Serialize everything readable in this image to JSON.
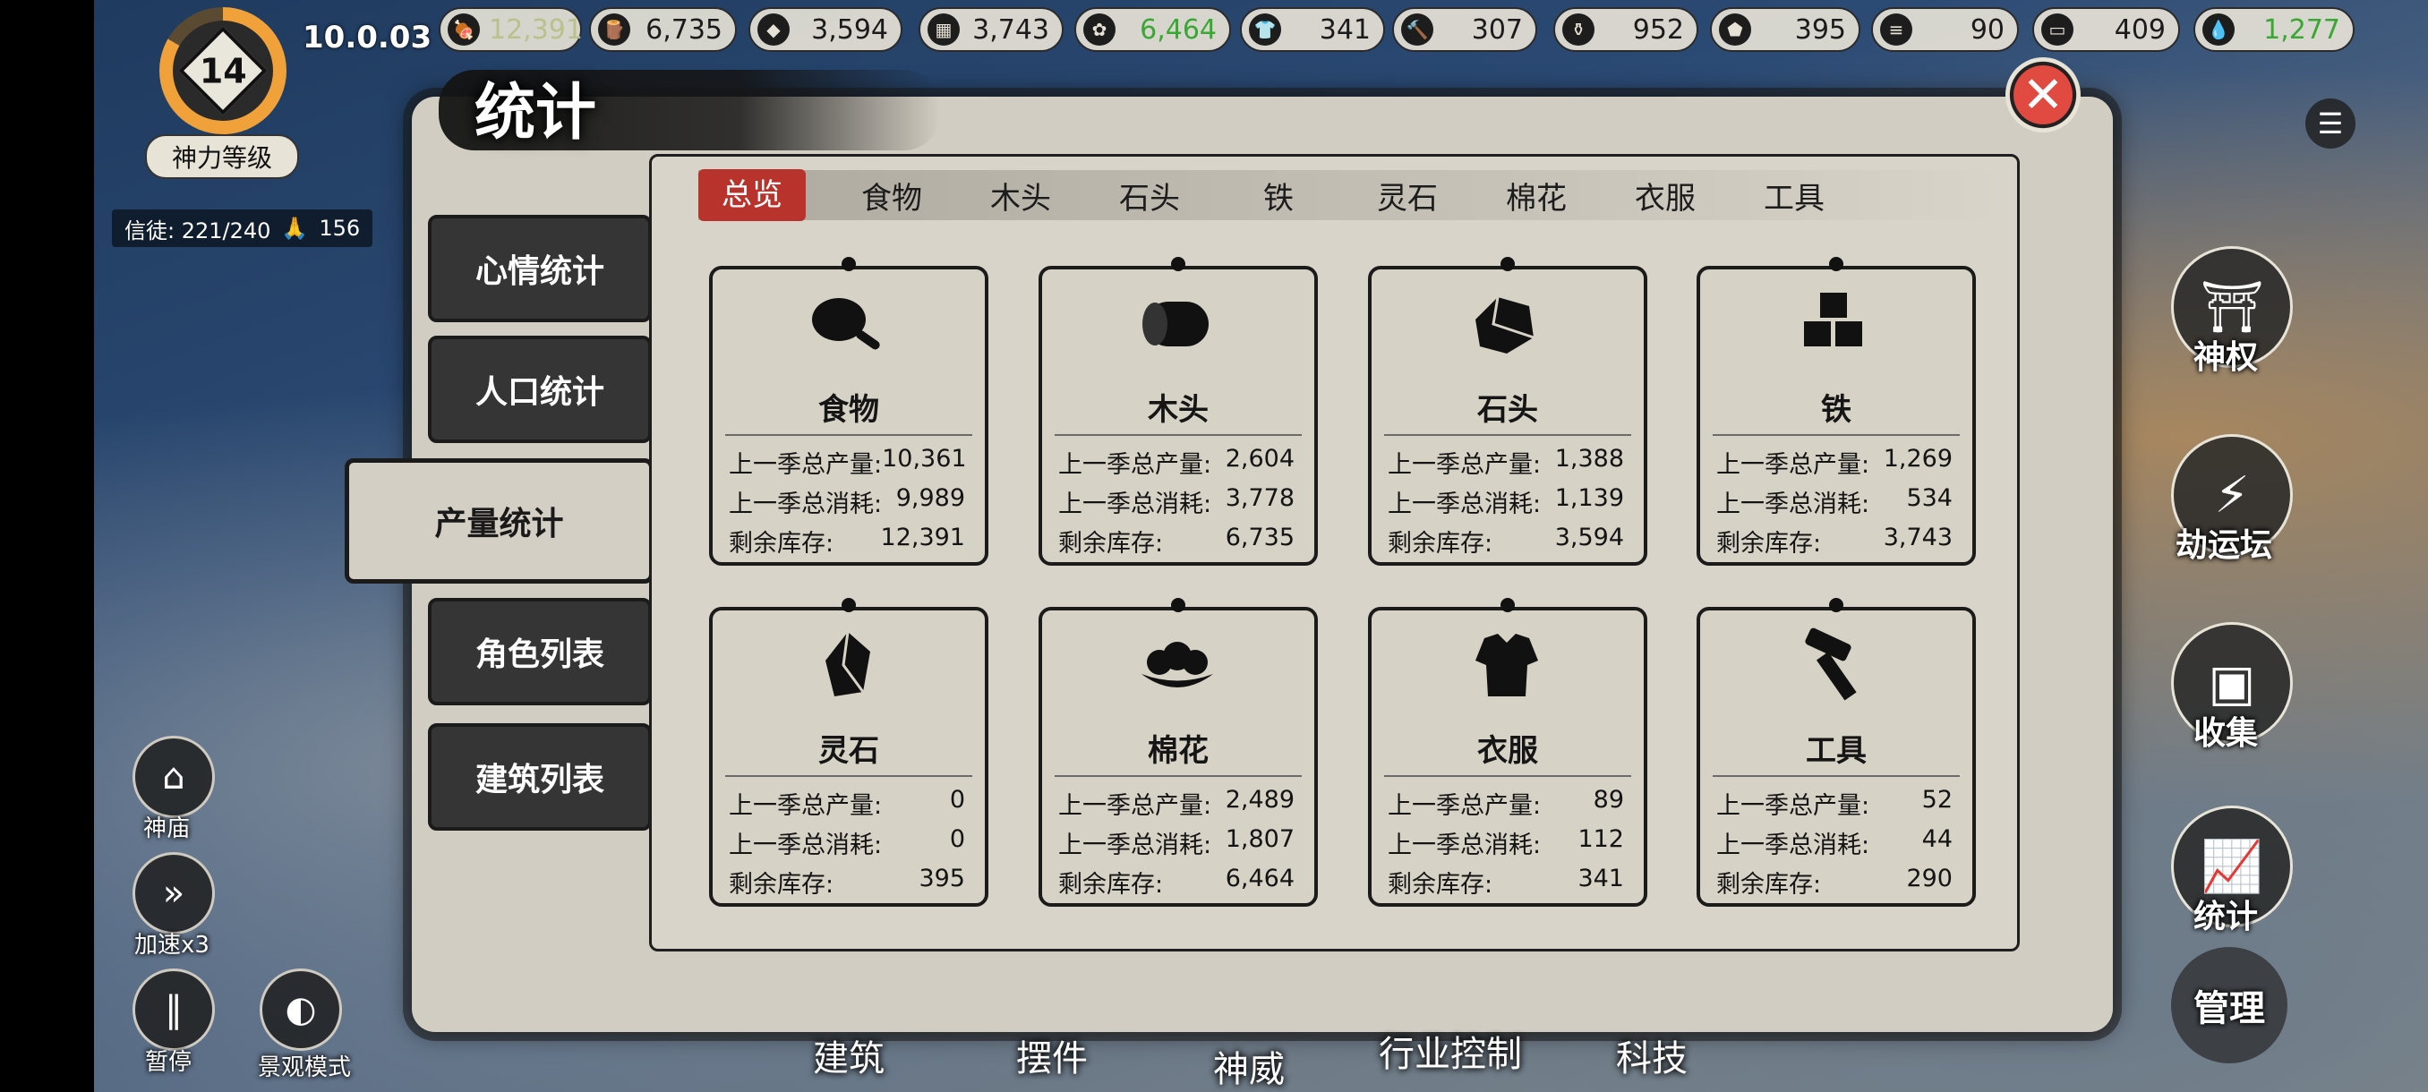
{
  "hud": {
    "level": "14",
    "level_label": "神力等级",
    "version": "10.0.03",
    "believers": "信徒: 221/240",
    "prayers": "156"
  },
  "resources": [
    {
      "icon": "meat-icon",
      "value": "12,391",
      "color": "#b8c28a"
    },
    {
      "icon": "wood-log-icon",
      "value": "6,735",
      "color": "#1b1b1b"
    },
    {
      "icon": "stone-icon",
      "value": "3,594",
      "color": "#1b1b1b"
    },
    {
      "icon": "iron-cubes-icon",
      "value": "3,743",
      "color": "#1b1b1b"
    },
    {
      "icon": "cotton-icon",
      "value": "6,464",
      "color": "#39a832"
    },
    {
      "icon": "clothes-icon",
      "value": "341",
      "color": "#1b1b1b"
    },
    {
      "icon": "hammer-icon",
      "value": "307",
      "color": "#1b1b1b"
    },
    {
      "icon": "pot-icon",
      "value": "952",
      "color": "#1b1b1b"
    },
    {
      "icon": "ore-icon",
      "value": "395",
      "color": "#1b1b1b"
    },
    {
      "icon": "incense-icon",
      "value": "90",
      "color": "#1b1b1b"
    },
    {
      "icon": "chest-icon",
      "value": "409",
      "color": "#1b1b1b"
    },
    {
      "icon": "drop-icon",
      "value": "1,277",
      "color": "#39a832"
    }
  ],
  "panel": {
    "title": "统计",
    "tabs": [
      "总览",
      "食物",
      "木头",
      "石头",
      "铁",
      "灵石",
      "棉花",
      "衣服",
      "工具"
    ],
    "active_tab": "总览",
    "side_tabs": [
      "心情统计",
      "人口统计",
      "产量统计",
      "角色列表",
      "建筑列表"
    ],
    "active_side": "产量统计"
  },
  "labels": {
    "produced": "上一季总产量:",
    "consumed": "上一季总消耗:",
    "stock": "剩余库存:"
  },
  "cards": [
    {
      "name": "食物",
      "icon": "meat-icon",
      "produced": "10,361",
      "consumed": "9,989",
      "stock": "12,391"
    },
    {
      "name": "木头",
      "icon": "wood-log-icon",
      "produced": "2,604",
      "consumed": "3,778",
      "stock": "6,735"
    },
    {
      "name": "石头",
      "icon": "stone-icon",
      "produced": "1,388",
      "consumed": "1,139",
      "stock": "3,594"
    },
    {
      "name": "铁",
      "icon": "iron-cubes-icon",
      "produced": "1,269",
      "consumed": "534",
      "stock": "3,743"
    },
    {
      "name": "灵石",
      "icon": "spirit-stone-icon",
      "produced": "0",
      "consumed": "0",
      "stock": "395"
    },
    {
      "name": "棉花",
      "icon": "cotton-icon",
      "produced": "2,489",
      "consumed": "1,807",
      "stock": "6,464"
    },
    {
      "name": "衣服",
      "icon": "clothes-icon",
      "produced": "89",
      "consumed": "112",
      "stock": "341"
    },
    {
      "name": "工具",
      "icon": "hammer-icon",
      "produced": "52",
      "consumed": "44",
      "stock": "290"
    }
  ],
  "right_menu": [
    "神权",
    "劫运坛",
    "收集",
    "统计",
    "管理"
  ],
  "bottom_nav": [
    "建筑",
    "摆件",
    "神威",
    "行业控制",
    "科技"
  ],
  "left_controls": [
    "神庙",
    "加速x3",
    "暂停",
    "景观模式"
  ]
}
